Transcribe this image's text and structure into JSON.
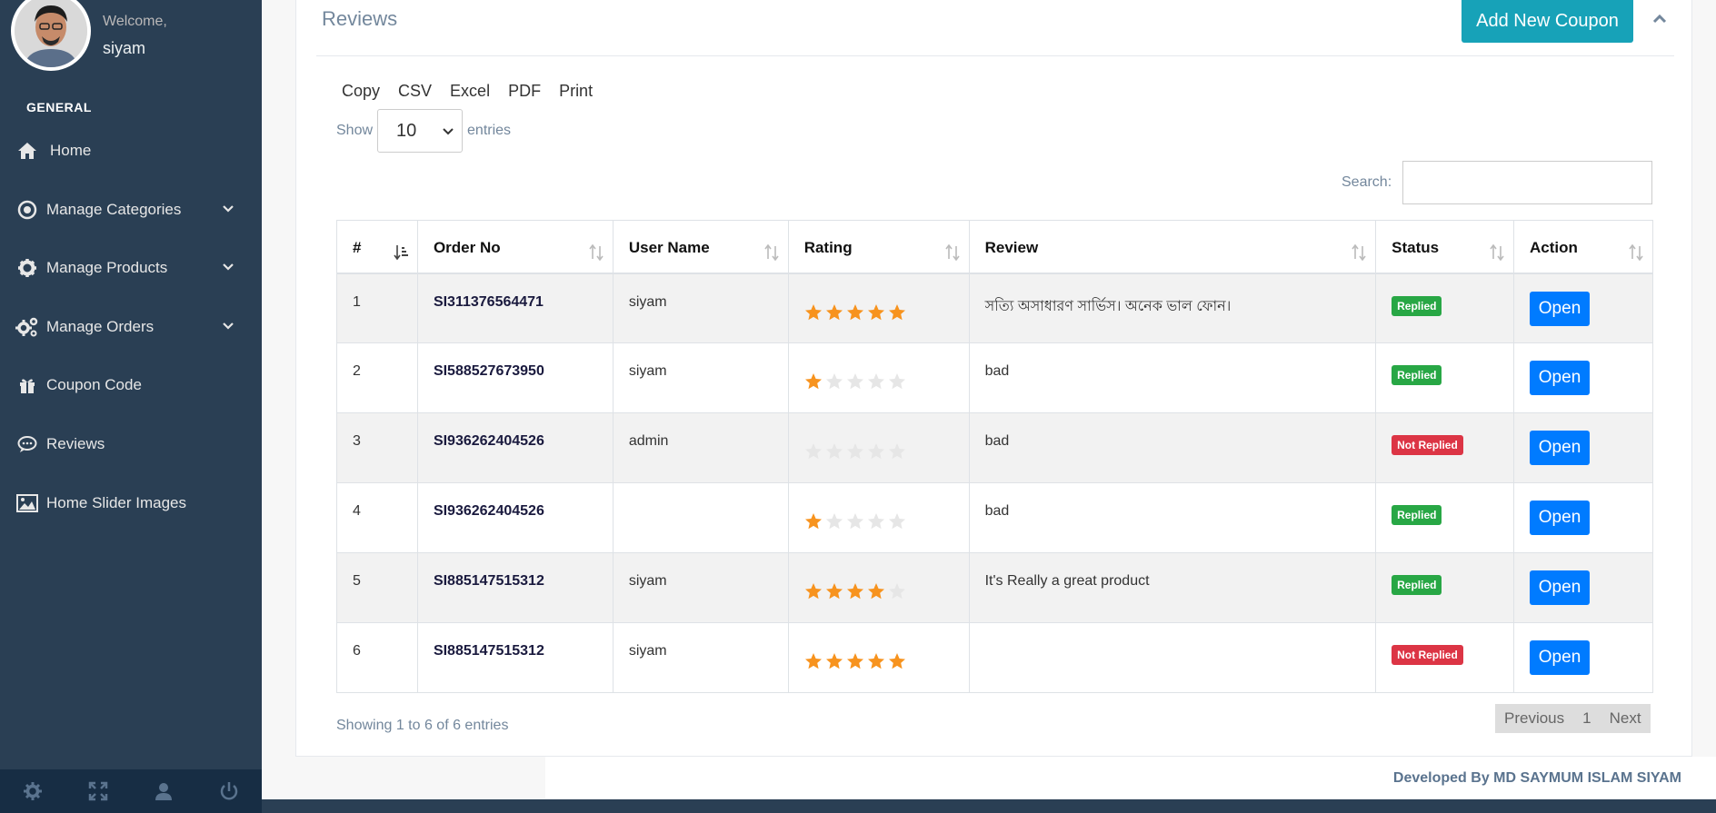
{
  "sidebar": {
    "welcome": "Welcome,",
    "username": "siyam",
    "section": "GENERAL",
    "items": [
      {
        "label": "Home",
        "icon": "home-icon"
      },
      {
        "label": "Manage Categories",
        "icon": "bullseye-icon",
        "has_submenu": true
      },
      {
        "label": "Manage Products",
        "icon": "gear-icon",
        "has_submenu": true
      },
      {
        "label": "Manage Orders",
        "icon": "gears-icon",
        "has_submenu": true
      },
      {
        "label": "Coupon Code",
        "icon": "gift-icon"
      },
      {
        "label": "Reviews",
        "icon": "comment-icon"
      },
      {
        "label": "Home Slider Images",
        "icon": "image-icon"
      }
    ],
    "footer_icons": [
      "settings-icon",
      "fullscreen-icon",
      "user-icon",
      "power-icon"
    ]
  },
  "panel": {
    "title": "Reviews",
    "add_button": "Add New Coupon"
  },
  "toolbar": {
    "export": [
      "Copy",
      "CSV",
      "Excel",
      "PDF",
      "Print"
    ],
    "show_label": "Show",
    "entries_value": "10",
    "entries_label": "entries",
    "search_label": "Search:",
    "search_value": ""
  },
  "table": {
    "columns": [
      "#",
      "Order No",
      "User Name",
      "Rating",
      "Review",
      "Status",
      "Action"
    ],
    "rows": [
      {
        "num": "1",
        "order": "SI311376564471",
        "user": "siyam",
        "rating": 5,
        "review": "সত্যি অসাধারণ সার্ভিস। অনেক ভাল ফোন।",
        "status": "Replied",
        "action": "Open"
      },
      {
        "num": "2",
        "order": "SI588527673950",
        "user": "siyam",
        "rating": 1,
        "review": "bad",
        "status": "Replied",
        "action": "Open"
      },
      {
        "num": "3",
        "order": "SI936262404526",
        "user": "admin",
        "rating": 0,
        "review": "bad",
        "status": "Not Replied",
        "action": "Open"
      },
      {
        "num": "4",
        "order": "SI936262404526",
        "user": "",
        "rating": 1,
        "review": "bad",
        "status": "Replied",
        "action": "Open"
      },
      {
        "num": "5",
        "order": "SI885147515312",
        "user": "siyam",
        "rating": 4,
        "review": "It's Really a great product",
        "status": "Replied",
        "action": "Open"
      },
      {
        "num": "6",
        "order": "SI885147515312",
        "user": "siyam",
        "rating": 5,
        "review": "",
        "status": "Not Replied",
        "action": "Open"
      }
    ]
  },
  "info": "Showing 1 to 6 of 6 entries",
  "pager": {
    "prev": "Previous",
    "page": "1",
    "next": "Next"
  },
  "footer": "Developed By MD SAYMUM ISLAM SIYAM",
  "colors": {
    "sidebar": "#2a3f54",
    "accent": "#17a2b8",
    "primary": "#007bff",
    "star": "#f7931e",
    "success": "#28a745",
    "danger": "#dc3545"
  }
}
